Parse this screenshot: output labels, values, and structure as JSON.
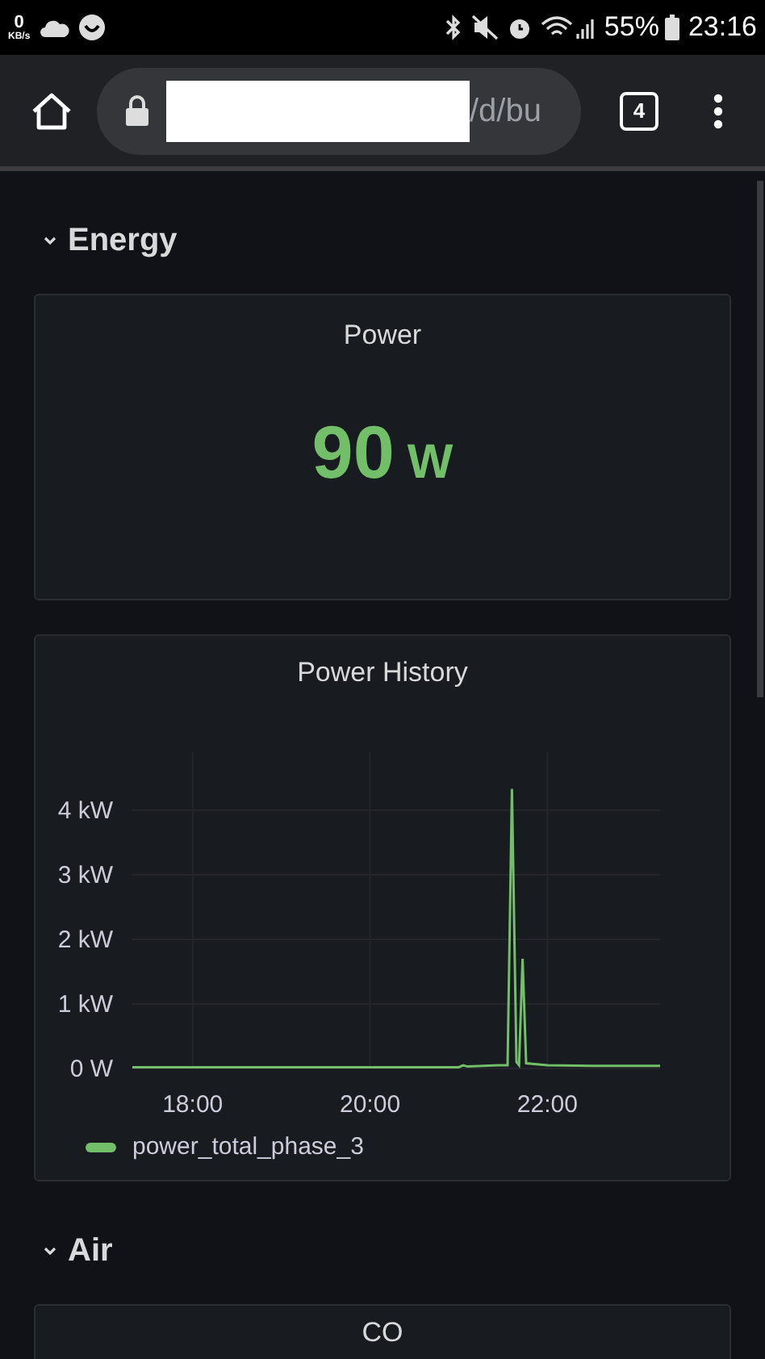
{
  "status_bar": {
    "speed": "0",
    "speed_unit": "KB/s",
    "battery": "55%",
    "time": "23:16"
  },
  "browser": {
    "url": "/d/bu",
    "tab_count": "4"
  },
  "sections": [
    {
      "title": "Energy",
      "expanded": true,
      "panels": [
        {
          "kind": "stat",
          "title": "Power",
          "value": "90",
          "unit": "W",
          "color": "#73bf69"
        },
        {
          "kind": "graph",
          "title": "Power History",
          "chart_data": {
            "type": "line",
            "x": [
              17.32,
              21.0,
              21.05,
              21.1,
              21.45,
              21.55,
              21.6,
              21.65,
              21.68,
              21.72,
              21.76,
              22.0,
              22.5,
              23.27
            ],
            "series": [
              {
                "name": "power_total_phase_3",
                "color": "#73bf69",
                "values": [
                  0.02,
                  0.02,
                  0.05,
                  0.03,
                  0.05,
                  0.05,
                  4.33,
                  0.1,
                  0.05,
                  1.7,
                  0.08,
                  0.05,
                  0.04,
                  0.04
                ]
              }
            ],
            "xlim": [
              17.32,
              23.27
            ],
            "ylim": [
              0,
              4.9
            ],
            "grid": true,
            "xticks": [
              {
                "value": 18,
                "label": "18:00"
              },
              {
                "value": 20,
                "label": "20:00"
              },
              {
                "value": 22,
                "label": "22:00"
              }
            ],
            "yticks": [
              {
                "value": 0,
                "label": "0 W"
              },
              {
                "value": 1,
                "label": "1 kW"
              },
              {
                "value": 2,
                "label": "2 kW"
              },
              {
                "value": 3,
                "label": "3 kW"
              },
              {
                "value": 4,
                "label": "4 kW"
              }
            ]
          }
        }
      ]
    },
    {
      "title": "Air",
      "expanded": true,
      "panels": [
        {
          "kind": "stub",
          "title": "CO"
        }
      ]
    }
  ]
}
